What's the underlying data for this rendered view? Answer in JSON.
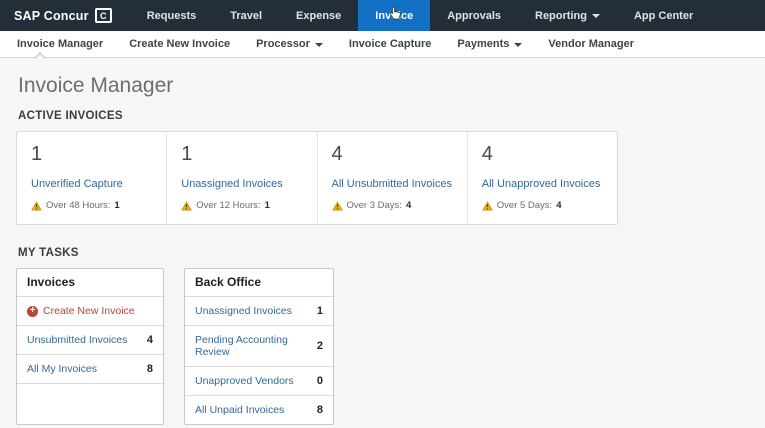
{
  "topbar": {
    "brand": "SAP Concur",
    "logo_letter": "C",
    "items": [
      {
        "label": "Requests"
      },
      {
        "label": "Travel"
      },
      {
        "label": "Expense"
      },
      {
        "label": "Invoice",
        "active": true
      },
      {
        "label": "Approvals"
      },
      {
        "label": "Reporting",
        "dropdown": true
      },
      {
        "label": "App Center"
      }
    ]
  },
  "subnav": {
    "items": [
      {
        "label": "Invoice Manager",
        "active": true
      },
      {
        "label": "Create New Invoice"
      },
      {
        "label": "Processor",
        "dropdown": true
      },
      {
        "label": "Invoice Capture"
      },
      {
        "label": "Payments",
        "dropdown": true
      },
      {
        "label": "Vendor Manager"
      }
    ]
  },
  "page": {
    "title": "Invoice Manager",
    "active_invoices": {
      "heading": "ACTIVE INVOICES",
      "cards": [
        {
          "count": "1",
          "label": "Unverified Capture",
          "warning_label": "Over 48 Hours:",
          "warning_count": "1"
        },
        {
          "count": "1",
          "label": "Unassigned Invoices",
          "warning_label": "Over 12 Hours:",
          "warning_count": "1"
        },
        {
          "count": "4",
          "label": "All Unsubmitted Invoices",
          "warning_label": "Over 3 Days:",
          "warning_count": "4"
        },
        {
          "count": "4",
          "label": "All Unapproved Invoices",
          "warning_label": "Over 5 Days:",
          "warning_count": "4"
        }
      ]
    },
    "my_tasks": {
      "heading": "MY TASKS",
      "panels": [
        {
          "title": "Invoices",
          "action_label": "Create New Invoice",
          "rows": [
            {
              "label": "Unsubmitted Invoices",
              "count": "4"
            },
            {
              "label": "All My Invoices",
              "count": "8"
            }
          ]
        },
        {
          "title": "Back Office",
          "rows": [
            {
              "label": "Unassigned Invoices",
              "count": "1"
            },
            {
              "label": "Pending Accounting Review",
              "count": "2"
            },
            {
              "label": "Unapproved Vendors",
              "count": "0"
            },
            {
              "label": "All Unpaid Invoices",
              "count": "8"
            }
          ]
        }
      ]
    }
  },
  "icons": {
    "brand_logo": "concur-c-badge",
    "nav_dropdown": "caret-down",
    "card_warning": "warning-triangle",
    "create_action": "plus-circle",
    "pointer": "hand-cursor"
  },
  "colors": {
    "topbar_bg": "#242e39",
    "active_tab_blue": "#1271c4",
    "link_blue": "#35689a",
    "action_red": "#b6453a",
    "warning_yellow": "#eca900",
    "content_bg": "#f6f6f5"
  }
}
